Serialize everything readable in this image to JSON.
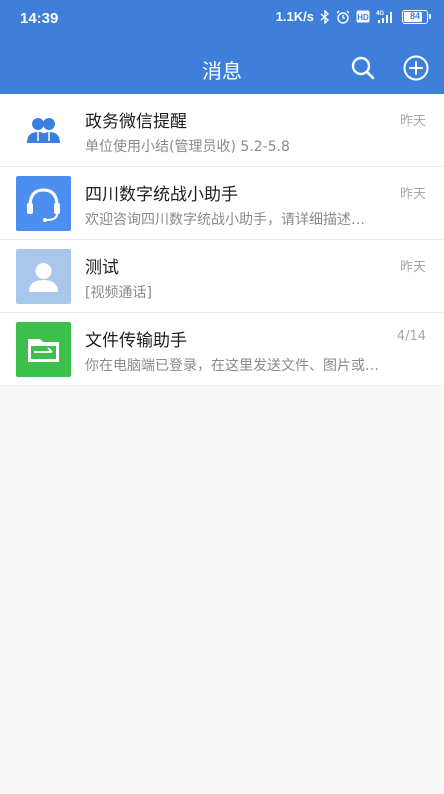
{
  "status_bar": {
    "time": "14:39",
    "net_speed": "1.1K/s",
    "network_type": "4G",
    "battery": "84",
    "icons": [
      "bluetooth-icon",
      "alarm-icon",
      "hd-icon",
      "signal-icon",
      "battery-icon"
    ]
  },
  "header": {
    "title": "消息",
    "icons": [
      "search-icon",
      "add-circle-icon"
    ],
    "color": "#3d7fdb"
  },
  "conversations": [
    {
      "name": "政务微信提醒",
      "preview": "单位使用小结(管理员收) 5.2-5.8",
      "time": "昨天",
      "avatar": "users-icon",
      "avatar_color": "#ffffff"
    },
    {
      "name": "四川数字统战小助手",
      "preview": "欢迎咨询四川数字统战小助手，请详细描述…",
      "time": "昨天",
      "avatar": "headset-icon",
      "avatar_color": "#4c8ff0"
    },
    {
      "name": "测试",
      "preview": "[视频通话]",
      "time": "昨天",
      "avatar": "person-icon",
      "avatar_color": "#a9c7ea"
    },
    {
      "name": "文件传输助手",
      "preview": "你在电脑端已登录，在这里发送文件、图片或…",
      "time": "4/14",
      "avatar": "folder-icon",
      "avatar_color": "#3cc04b"
    }
  ]
}
